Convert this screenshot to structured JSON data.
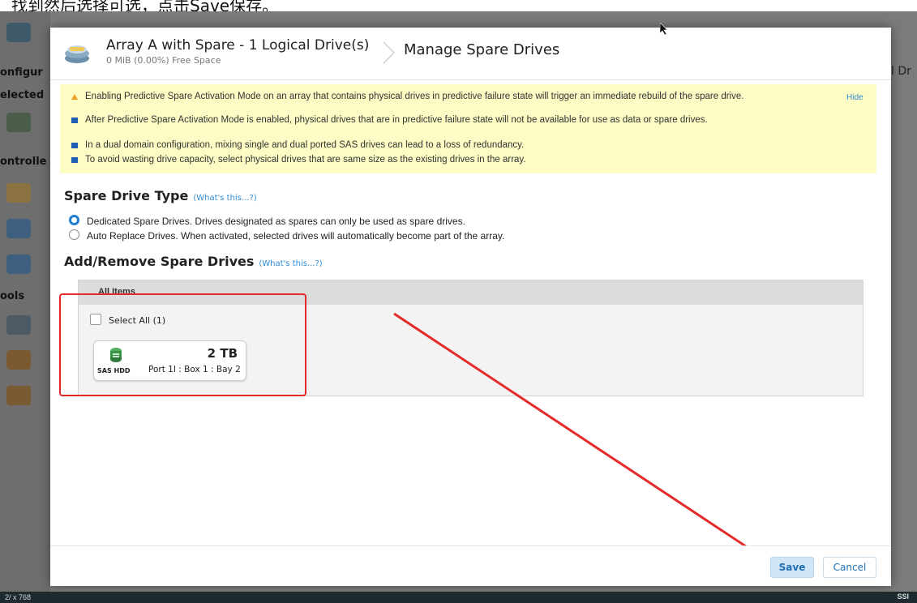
{
  "caption_top": "找到然后选择可选，点击Save保存。",
  "background": {
    "sidebar_labels": [
      "onfigur",
      "elected",
      "ontrolle",
      "ools"
    ],
    "right_fragment": "l Dr"
  },
  "statusbar": {
    "left": "2/ x 768",
    "right": "SSI"
  },
  "modal": {
    "array_title": "Array A with Spare - 1 Logical Drive(s)",
    "array_subtitle": "0 MiB (0.00%) Free Space",
    "page_title": "Manage Spare Drives",
    "warnings": [
      "Enabling Predictive Spare Activation Mode on an array that contains physical drives in predictive failure state will trigger an immediate rebuild of the spare drive.",
      "After Predictive Spare Activation Mode is enabled, physical drives that are in predictive failure state will not be available for use as data or spare drives.",
      "In a dual domain configuration, mixing single and dual ported SAS drives can lead to a loss of redundancy.",
      "To avoid wasting drive capacity, select physical drives that are same size as the existing drives in the array."
    ],
    "hide_link": "Hide",
    "spare_type": {
      "title": "Spare Drive Type",
      "whats_this": "(What's this...?)",
      "options": [
        {
          "label": "Dedicated Spare Drives. Drives designated as spares can only be used as spare drives.",
          "selected": true
        },
        {
          "label": "Auto Replace Drives. When activated, selected drives will automatically become part of the array.",
          "selected": false
        }
      ]
    },
    "add_remove": {
      "title": "Add/Remove Spare Drives",
      "whats_this": "(What's this...?)",
      "panel_header": "All Items",
      "select_all": "Select All (1)",
      "drive": {
        "size": "2 TB",
        "type": "SAS HDD",
        "location": "Port 1I : Box 1 : Bay 2"
      }
    },
    "footer": {
      "save": "Save",
      "cancel": "Cancel"
    }
  },
  "colors": {
    "accent": "#1e7fd0",
    "warning_bg": "#fdfcc4",
    "annotation_red": "#e52a2a"
  }
}
